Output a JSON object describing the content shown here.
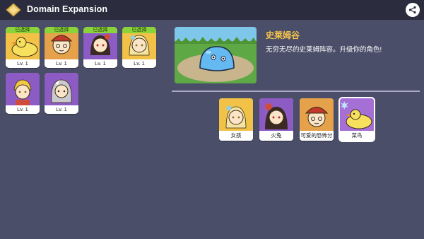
{
  "header": {
    "title": "Domain Expansion",
    "logo_icon": "diamond-icon",
    "share_icon": "share-icon"
  },
  "owned_cards": [
    {
      "badge": "已选择",
      "level": "Lv. 1",
      "portrait": "chick",
      "bg": "#f2c248"
    },
    {
      "badge": "已选择",
      "level": "Lv. 1",
      "portrait": "girl-red-hat",
      "bg": "#e6a24b"
    },
    {
      "badge": "已选择",
      "level": "Lv. 1",
      "portrait": "girl-dark-hair",
      "bg": "#8d5bc4"
    },
    {
      "badge": "已选择",
      "level": "Lv. 1",
      "portrait": "girl-blonde",
      "bg": "#f2c248"
    },
    {
      "badge": "",
      "level": "Lv. 1",
      "portrait": "boy-blonde",
      "bg": "#8d5bc4"
    },
    {
      "badge": "",
      "level": "Lv. 1",
      "portrait": "silver-hair",
      "bg": "#8d5bc4"
    }
  ],
  "region": {
    "title": "史莱姆谷",
    "description": "无穷无尽的史莱姆阵容。升级你的角色!",
    "image": "slime-preview"
  },
  "characters": [
    {
      "name": "女孩",
      "portrait": "girl-blonde",
      "bg": "#f2c248",
      "selected": false
    },
    {
      "name": "火兔",
      "portrait": "girl-dark-hair",
      "bg": "#8d5bc4",
      "selected": false
    },
    {
      "name": "可爱的恐怖分",
      "portrait": "girl-red-hat",
      "bg": "#e6a24b",
      "selected": false
    },
    {
      "name": "菜鸟",
      "portrait": "chick",
      "bg": "#a56fd6",
      "selected": true
    }
  ],
  "colors": {
    "background": "#4a4e68",
    "topbar": "#2b2c3d",
    "accent_gold": "#f7c44a",
    "badge_green": "#8bd33a"
  }
}
